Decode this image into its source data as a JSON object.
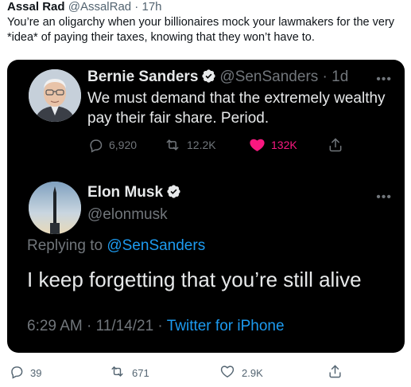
{
  "outer_tweet": {
    "author_name": "Assal Rad",
    "handle_time": "@AssalRad · 17h",
    "text": "You’re an oligarchy when your billionaires mock your lawmakers for the very *idea* of paying their taxes, knowing that they won’t have to.",
    "actions": {
      "reply_count": "39",
      "retweet_count": "671",
      "like_count": "2.9K"
    }
  },
  "quoted_tweet": {
    "author_name": "Bernie Sanders",
    "handle_time": "@SenSanders · 1d",
    "text": "We must demand that the extremely wealthy pay their fair share. Period.",
    "actions": {
      "reply_count": "6,920",
      "retweet_count": "12.2K",
      "like_count": "132K"
    }
  },
  "reply_tweet": {
    "author_name": "Elon Musk",
    "handle": "@elonmusk",
    "replying_prefix": "Replying to",
    "replying_to": "@SenSanders",
    "text": "I keep forgetting that you’re still alive",
    "timestamp": "6:29 AM · 11/14/21 ·",
    "source": "Twitter for iPhone"
  },
  "icons": {
    "verified": "verified-badge-icon",
    "more": "more-icon",
    "reply": "reply-icon",
    "retweet": "retweet-icon",
    "like": "heart-icon",
    "share": "share-icon"
  },
  "colors": {
    "accent": "#1d9bf0",
    "like": "#f91880",
    "dark_bg": "#000000",
    "muted": "#71767b",
    "text_light": "#e7e9ea"
  }
}
